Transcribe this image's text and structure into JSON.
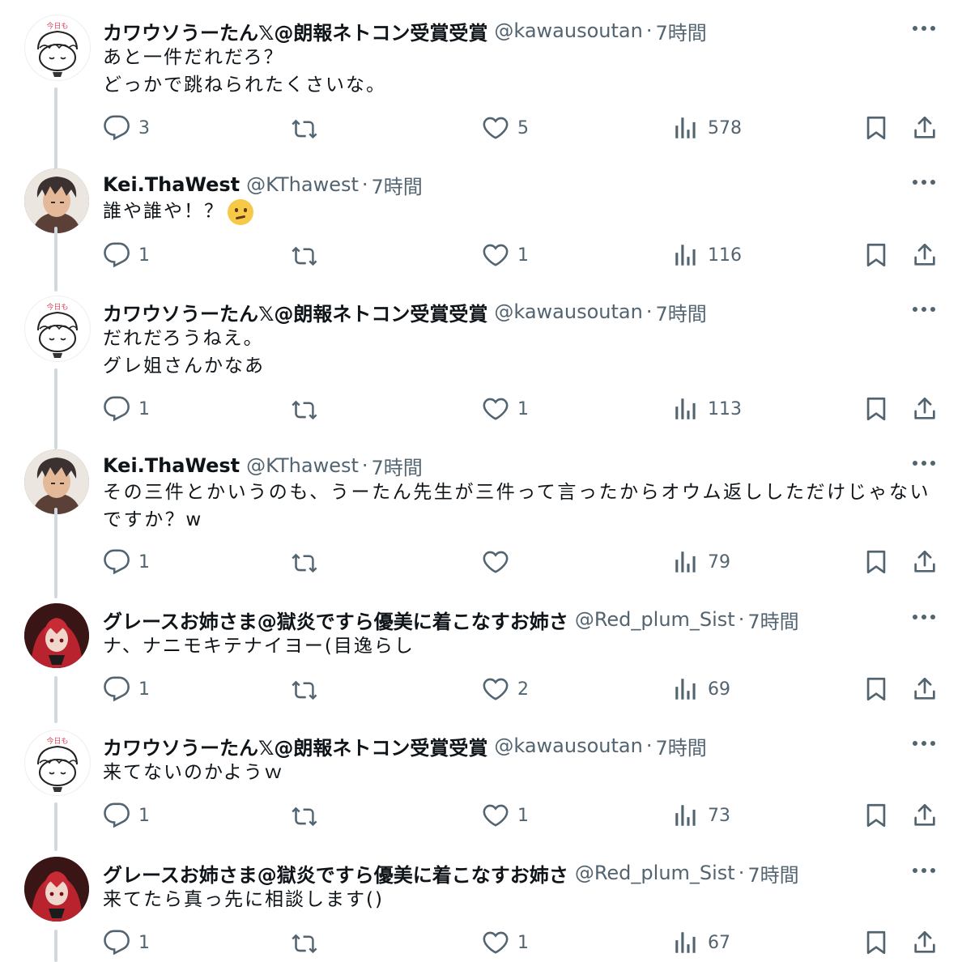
{
  "tweets": [
    {
      "avatar": "kawa-sketch-avatar",
      "name": "カワウソうーたん𝕏@朗報ネトコン受賞受賞",
      "handle": "@kawausoutan",
      "time": "7時間",
      "text": "あと一件だれだろ？\nどっかで跳ねられたくさいな。",
      "emoji": "",
      "replies": "3",
      "retweets": "",
      "likes": "5",
      "views": "578"
    },
    {
      "avatar": "kei-portrait-avatar",
      "name": "Kei.ThaWest",
      "handle": "@KThawest",
      "time": "7時間",
      "text": "誰や誰や！？",
      "emoji": "thinking-face-emoji",
      "replies": "1",
      "retweets": "",
      "likes": "1",
      "views": "116"
    },
    {
      "avatar": "kawa-sketch-avatar",
      "name": "カワウソうーたん𝕏@朗報ネトコン受賞受賞",
      "handle": "@kawausoutan",
      "time": "7時間",
      "text": "だれだろうねえ。\nグレ姐さんかなあ",
      "emoji": "",
      "replies": "1",
      "retweets": "",
      "likes": "1",
      "views": "113"
    },
    {
      "avatar": "kei-portrait-avatar",
      "name": "Kei.ThaWest",
      "handle": "@KThawest",
      "time": "7時間",
      "text": "その三件とかいうのも、うーたん先生が三件って言ったからオウム返ししただけじゃないですか？w",
      "emoji": "",
      "replies": "1",
      "retweets": "",
      "likes": "",
      "views": "79"
    },
    {
      "avatar": "grace-anime-avatar",
      "name": "グレースお姉さま@獄炎ですら優美に着こなすお姉さ",
      "handle": "@Red_plum_Sist",
      "time": "7時間",
      "text": "ナ、ナニモキテナイヨー(目逸らし",
      "emoji": "",
      "replies": "1",
      "retweets": "",
      "likes": "2",
      "views": "69"
    },
    {
      "avatar": "kawa-sketch-avatar",
      "name": "カワウソうーたん𝕏@朗報ネトコン受賞受賞",
      "handle": "@kawausoutan",
      "time": "7時間",
      "text": "来てないのかようｗ",
      "emoji": "",
      "replies": "1",
      "retweets": "",
      "likes": "1",
      "views": "73"
    },
    {
      "avatar": "grace-anime-avatar",
      "name": "グレースお姉さま@獄炎ですら優美に着こなすお姉さ",
      "handle": "@Red_plum_Sist",
      "time": "7時間",
      "text": "来てたら真っ先に相談します()",
      "emoji": "",
      "replies": "1",
      "retweets": "",
      "likes": "1",
      "views": "67"
    }
  ],
  "dot": "·",
  "icons": {
    "more": "more-icon",
    "reply": "reply-icon",
    "retweet": "retweet-icon",
    "like": "like-icon",
    "views": "views-icon",
    "bookmark": "bookmark-icon",
    "share": "share-icon"
  },
  "colors": {
    "text": "#0f1419",
    "secondary": "#536471",
    "thread_line": "#cfd9de"
  }
}
